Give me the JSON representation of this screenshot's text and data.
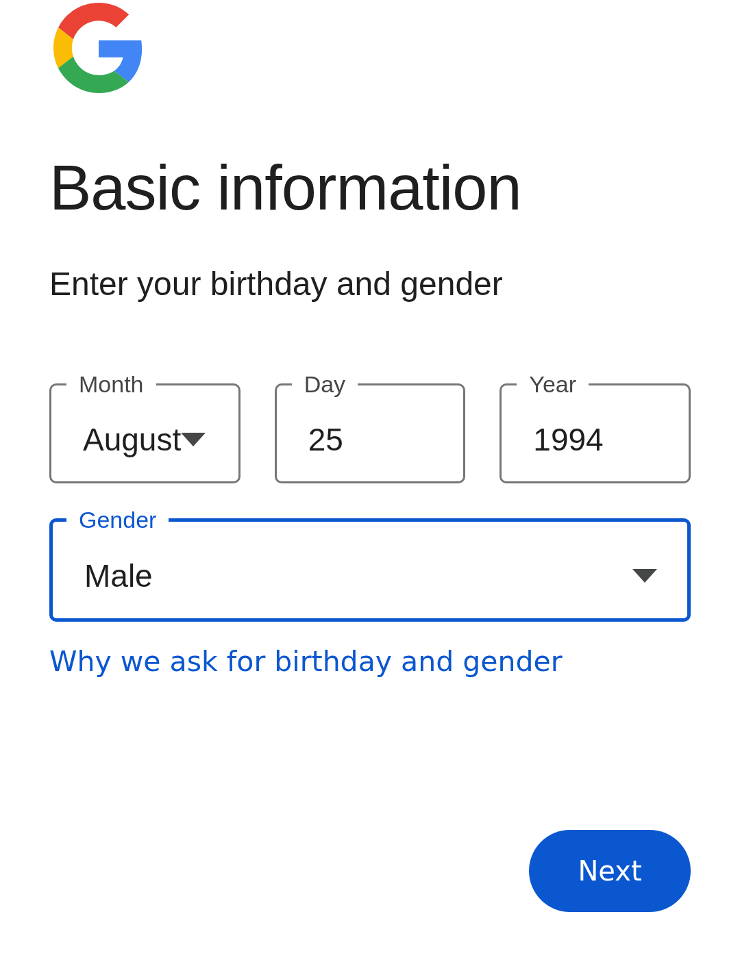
{
  "title": "Basic information",
  "subtitle": "Enter your birthday and gender",
  "date_fields": [
    {
      "kind": "select",
      "label": "Month",
      "value": "August",
      "focused": false
    },
    {
      "kind": "text",
      "label": "Day",
      "value": "25",
      "focused": false
    },
    {
      "kind": "text",
      "label": "Year",
      "value": "1994",
      "focused": false
    }
  ],
  "gender_field": {
    "kind": "select",
    "label": "Gender",
    "value": "Male",
    "focused": true
  },
  "help_link": "Why we ask for birthday and gender",
  "next_button": "Next"
}
